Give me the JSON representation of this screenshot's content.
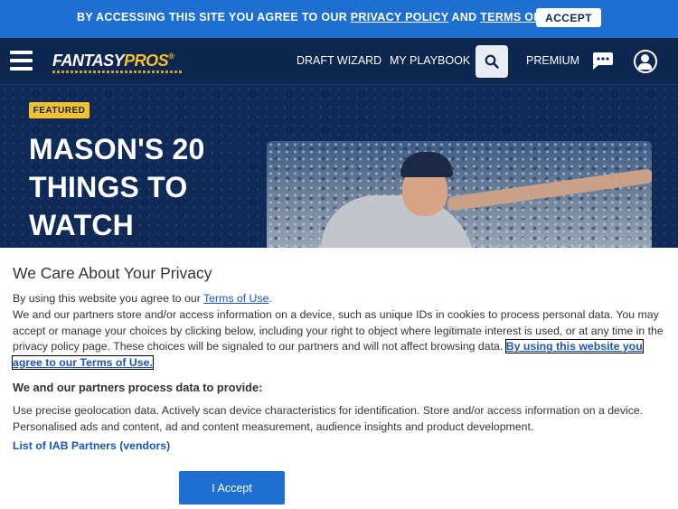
{
  "consent_bar": {
    "prefix": "BY ACCESSING THIS SITE YOU AGREE TO OUR ",
    "privacy_link": "PRIVACY POLICY",
    "and": " AND ",
    "terms_link": "TERMS OF USE",
    "suffix": ".",
    "accept_label": "ACCEPT"
  },
  "nav": {
    "logo_main": "FANTASY",
    "logo_accent": "PROS",
    "logo_mark": "®",
    "links": [
      "DRAFT WIZARD",
      "MY PLAYBOOK",
      "PREMIUM"
    ],
    "icons": [
      "hamburger-icon",
      "search-icon",
      "chat-icon",
      "user-icon"
    ]
  },
  "hero": {
    "badge": "FEATURED",
    "title": "MASON'S 20 THINGS TO WATCH"
  },
  "privacy": {
    "heading": "We Care About Your Privacy",
    "p1_prefix": "By using this website you agree to our ",
    "p1_link": "Terms of Use",
    "p1_suffix": ".",
    "p2_text": "We and our partners store and/or access information on a device, such as unique IDs in cookies to process personal data. You may accept or manage your choices by clicking below, including your right to object where legitimate interest is used, or at any time in the privacy policy page. These choices will be signaled to our partners and will not affect browsing data. ",
    "p2_link": "By using this website you agree to our Terms of Use.",
    "process_heading": "We and our partners process data to provide:",
    "purposes": "Use precise geolocation data. Actively scan device characteristics for identification. Store and/or access information on a device. Personalised ads and content, ad and content measurement, audience insights and product development.",
    "partners_link": "List of IAB Partners (vendors)",
    "accept_label": "I Accept"
  },
  "colors": {
    "consent_bar": "#1f6fd1",
    "nav_bg": "#0d2650",
    "accent": "#f6c12a",
    "link": "#1a56b8"
  }
}
